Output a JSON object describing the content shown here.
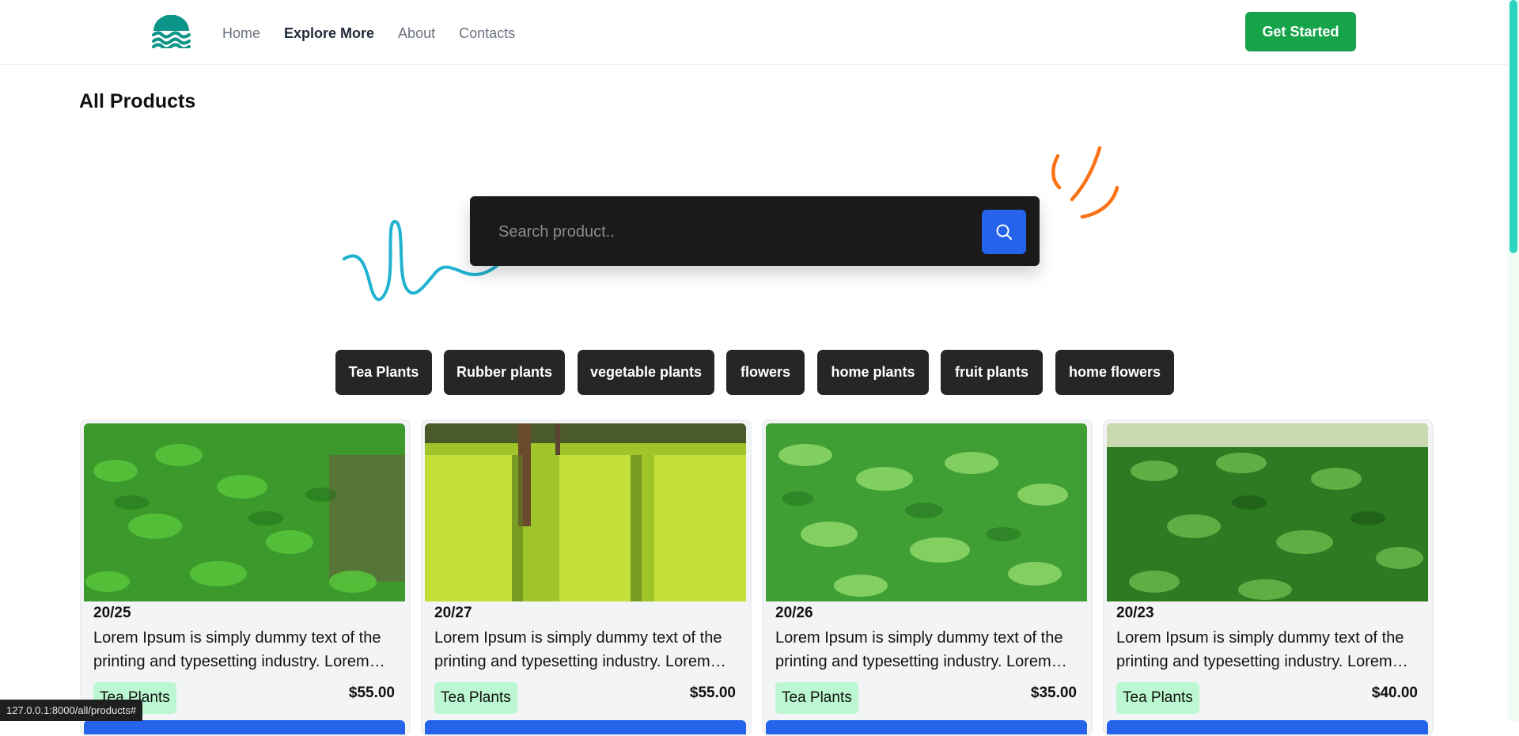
{
  "nav": {
    "links": [
      {
        "label": "Home",
        "active": false
      },
      {
        "label": "Explore More",
        "active": true
      },
      {
        "label": "About",
        "active": false
      },
      {
        "label": "Contacts",
        "active": false
      }
    ],
    "cta_label": "Get Started"
  },
  "page": {
    "title": "All Products"
  },
  "search": {
    "placeholder": "Search product..",
    "value": ""
  },
  "categories": [
    "Tea Plants",
    "Rubber plants",
    "vegetable plants",
    "flowers",
    "home plants",
    "fruit plants",
    "home flowers"
  ],
  "products": [
    {
      "code": "20/25",
      "description": "Lorem Ipsum is simply dummy text of the printing and typesetting industry. Lorem Ipsum has been the industry's standard dummy text.",
      "category": "Tea Plants",
      "price": "$55.00"
    },
    {
      "code": "20/27",
      "description": "Lorem Ipsum is simply dummy text of the printing and typesetting industry. Lorem Ipsum has been the industry's standard dummy text.",
      "category": "Tea Plants",
      "price": "$55.00"
    },
    {
      "code": "20/26",
      "description": "Lorem Ipsum is simply dummy text of the printing and typesetting industry. Lorem Ipsum has been the industry's standard dummy text.",
      "category": "Tea Plants",
      "price": "$35.00"
    },
    {
      "code": "20/23",
      "description": "Lorem Ipsum is simply dummy text of the printing and typesetting industry. Lorem Ipsum has been the industry's standard dummy text.",
      "category": "Tea Plants",
      "price": "$40.00"
    }
  ],
  "status_bar": {
    "url": "127.0.0.1:8000/all/products#"
  },
  "colors": {
    "accent_green": "#16a34a",
    "accent_blue": "#2563eb",
    "tag_green": "#bbf7d0",
    "logo_teal": "#0d9488"
  },
  "icons": {
    "logo": "waves-logo-icon",
    "search": "search-icon"
  }
}
